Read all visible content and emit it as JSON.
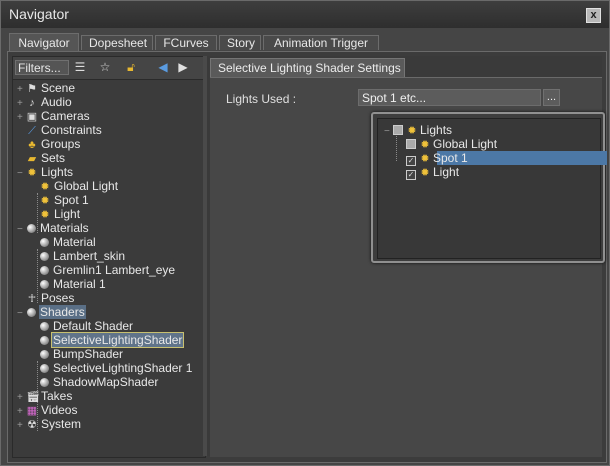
{
  "window": {
    "title": "Navigator",
    "close_label": "x"
  },
  "tabs": [
    {
      "label": "Navigator",
      "active": true
    },
    {
      "label": "Dopesheet",
      "active": false
    },
    {
      "label": "FCurves",
      "active": false
    },
    {
      "label": "Story",
      "active": false
    },
    {
      "label": "Animation Trigger",
      "active": false
    }
  ],
  "toolbar": {
    "filters_label": "Filters...",
    "icons": [
      "list-icon",
      "star-icon",
      "lock-icon",
      "arrow-left-icon",
      "arrow-right-icon"
    ]
  },
  "tree": [
    {
      "label": "Scene",
      "icon": "scene-icon",
      "expander": "+"
    },
    {
      "label": "Audio",
      "icon": "audio-icon",
      "expander": "+"
    },
    {
      "label": "Cameras",
      "icon": "camera-icon",
      "expander": "+"
    },
    {
      "label": "Constraints",
      "icon": "constraint-icon",
      "expander": ""
    },
    {
      "label": "Groups",
      "icon": "group-icon",
      "expander": ""
    },
    {
      "label": "Sets",
      "icon": "set-icon",
      "expander": ""
    },
    {
      "label": "Lights",
      "icon": "light-icon",
      "expander": "−"
    },
    {
      "label": "Global Light",
      "icon": "light-icon",
      "child": true
    },
    {
      "label": "Spot 1",
      "icon": "light-icon",
      "child": true
    },
    {
      "label": "Light",
      "icon": "light-icon",
      "child": true
    },
    {
      "label": "Materials",
      "icon": "sphere-icon",
      "expander": "−"
    },
    {
      "label": "Material",
      "icon": "sphere-icon",
      "child": true
    },
    {
      "label": "Lambert_skin",
      "icon": "sphere-icon",
      "child": true
    },
    {
      "label": "Gremlin1 Lambert_eye",
      "icon": "sphere-icon",
      "child": true
    },
    {
      "label": "Material 1",
      "icon": "sphere-icon",
      "child": true
    },
    {
      "label": "Poses",
      "icon": "pose-icon",
      "expander": ""
    },
    {
      "label": "Shaders",
      "icon": "sphere-icon",
      "expander": "−",
      "selected": true
    },
    {
      "label": "Default Shader",
      "icon": "sphere-icon",
      "child": true
    },
    {
      "label": "SelectiveLightingShader",
      "icon": "sphere-icon",
      "child": true,
      "focused": true
    },
    {
      "label": "BumpShader",
      "icon": "sphere-icon",
      "child": true
    },
    {
      "label": "SelectiveLightingShader 1",
      "icon": "sphere-icon",
      "child": true
    },
    {
      "label": "ShadowMapShader",
      "icon": "sphere-icon",
      "child": true
    },
    {
      "label": "Takes",
      "icon": "take-icon",
      "expander": "+"
    },
    {
      "label": "Videos",
      "icon": "video-icon",
      "expander": "+"
    },
    {
      "label": "System",
      "icon": "system-icon",
      "expander": "+"
    }
  ],
  "settings": {
    "tab_label": "Selective Lighting Shader Settings",
    "lights_used_label": "Lights Used :",
    "lights_used_value": "Spot 1 etc...",
    "browse_label": "..."
  },
  "popup_tree": {
    "root": {
      "label": "Lights",
      "expander": "−"
    },
    "items": [
      {
        "label": "Global Light",
        "checked": false
      },
      {
        "label": "Spot 1",
        "checked": true,
        "selected": true
      },
      {
        "label": "Light",
        "checked": true
      }
    ]
  },
  "colors": {
    "selection": "#4c78a6",
    "light_icon": "#f0c23a"
  }
}
